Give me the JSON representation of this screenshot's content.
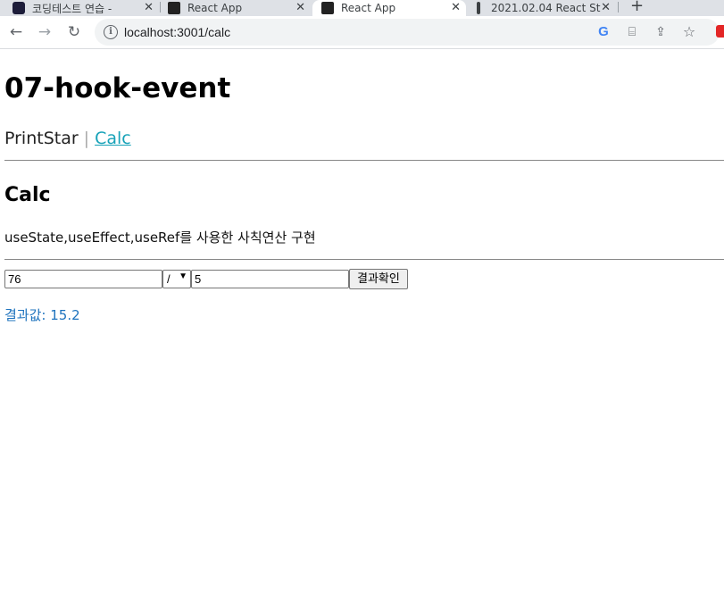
{
  "browser": {
    "tabs": [
      {
        "title": "코딩테스트 연습 - "
      },
      {
        "title": "React App"
      },
      {
        "title": "React App"
      },
      {
        "title": "2021.02.04 React St"
      }
    ],
    "url": "localhost:3001/calc"
  },
  "page": {
    "title": "07-hook-event",
    "nav": {
      "item1": "PrintStar",
      "separator": "|",
      "item2": "Calc"
    },
    "section_title": "Calc",
    "description": "useState,useEffect,useRef를 사용한 사칙연산 구현",
    "calc": {
      "operand1": "76",
      "operator": "/",
      "operand2": "5",
      "button_label": "결과확인"
    },
    "result_label": "결과값:",
    "result_value": "15.2"
  },
  "colors": {
    "link": "#17a2b8",
    "result": "#1e73be"
  }
}
